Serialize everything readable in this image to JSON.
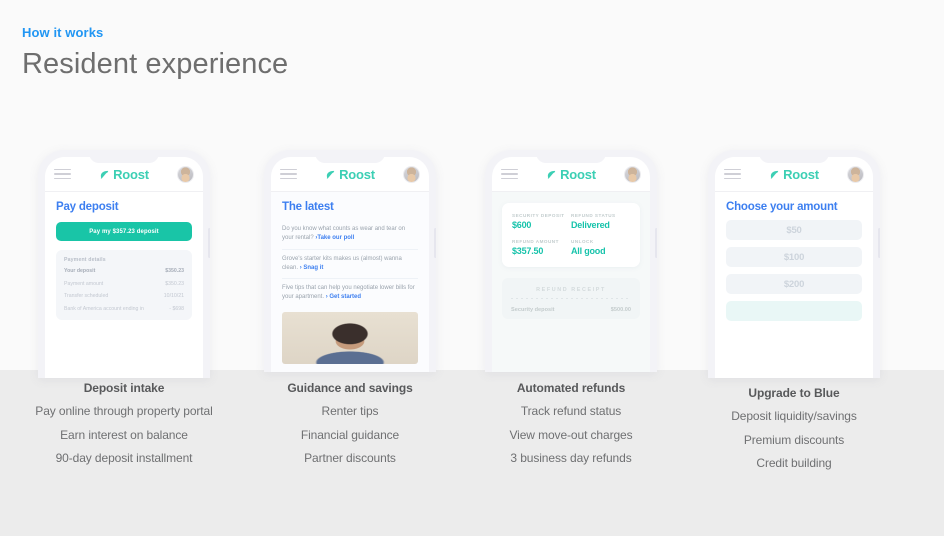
{
  "header": {
    "eyebrow": "How it works",
    "title": "Resident experience",
    "eyebrow_color": "#2196f3",
    "title_color": "#6e6e6e"
  },
  "brand": {
    "name": "Roost",
    "logo_color": "#3ccfb4",
    "accent_teal": "#19c5a7",
    "accent_blue": "#3d7ff0"
  },
  "phones": [
    {
      "heading": "Pay deposit",
      "cta": "Pay my $357.23 deposit",
      "card_title": "Payment details",
      "rows": [
        {
          "label": "Your deposit",
          "value": "$350.23"
        },
        {
          "label": "Payment amount",
          "value": "$350.23"
        },
        {
          "label": "Transfer scheduled",
          "value": "10/10/21"
        },
        {
          "label": "Bank of America account ending in",
          "value": "- $698"
        }
      ]
    },
    {
      "heading": "The latest",
      "items": [
        {
          "text": "Do you know what counts as wear and tear on your rental? ",
          "link": "›Take our poll"
        },
        {
          "text": "Grove's starter kits makes us (almost) wanna clean. ",
          "link": "› Snag it"
        },
        {
          "text": "Five tips that can help you negotiate lower bills for your apartment. ",
          "link": "› Get started"
        }
      ]
    },
    {
      "stats": [
        {
          "label": "SECURITY DEPOSIT",
          "value": "$600"
        },
        {
          "label": "REFUND STATUS",
          "value": "Delivered"
        },
        {
          "label": "REFUND AMOUNT",
          "value": "$357.50"
        },
        {
          "label": "UNLOCK",
          "value": "All good"
        }
      ],
      "receipt_title": "REFUND RECEIPT",
      "receipt_rows": [
        {
          "label": "Security deposit",
          "value": "$500.00"
        }
      ]
    },
    {
      "heading": "Choose your amount",
      "amounts": [
        "$50",
        "$100",
        "$200"
      ]
    }
  ],
  "captions": [
    {
      "title": "Deposit intake",
      "lines": [
        "Pay online through property portal",
        "Earn interest on balance",
        "90-day deposit installment"
      ]
    },
    {
      "title": "Guidance and savings",
      "lines": [
        "Renter tips",
        "Financial guidance",
        "Partner discounts"
      ]
    },
    {
      "title": "Automated refunds",
      "lines": [
        "Track refund status",
        "View move-out charges",
        "3 business day refunds"
      ]
    },
    {
      "title": "Upgrade to Blue",
      "lines": [
        "Deposit liquidity/savings",
        "Premium discounts",
        "Credit building"
      ]
    }
  ]
}
